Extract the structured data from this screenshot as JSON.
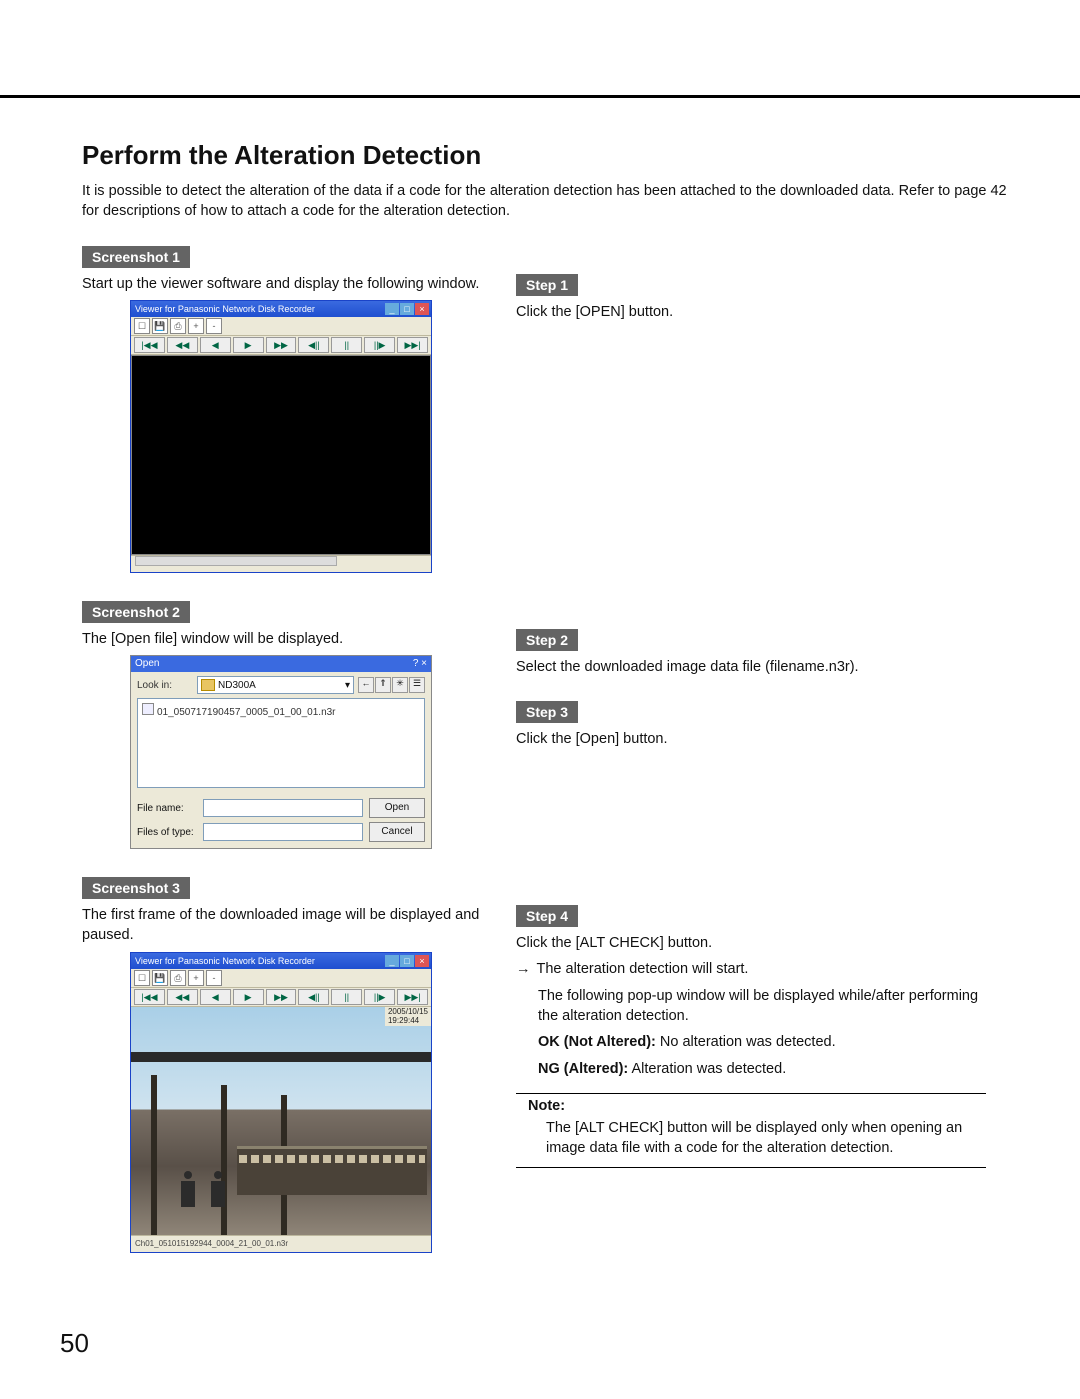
{
  "page_number": "50",
  "heading": "Perform the Alteration Detection",
  "intro": "It is possible to detect the alteration of the data if a code for the alteration detection has been attached to the downloaded data. Refer to page 42 for descriptions of how to attach a code for the alteration detection.",
  "screenshot1": {
    "label": "Screenshot 1",
    "caption": "Start up the viewer software and display the following window.",
    "window": {
      "title": "Viewer for Panasonic Network Disk Recorder",
      "toolbar_icons": [
        "open-icon",
        "save-icon",
        "print-icon",
        "zoom-in-icon",
        "zoom-out-icon"
      ],
      "transport": [
        "|◀◀",
        "◀◀",
        "◀",
        "▶",
        "▶▶",
        "◀||",
        "||",
        "||▶",
        "▶▶|"
      ]
    }
  },
  "step1": {
    "label": "Step 1",
    "text": "Click the [OPEN] button."
  },
  "screenshot2": {
    "label": "Screenshot 2",
    "caption": "The [Open file] window will be displayed.",
    "dialog": {
      "title": "Open",
      "lookin_label": "Look in:",
      "lookin_value": "ND300A",
      "file_listed": "01_050717190457_0005_01_00_01.n3r",
      "filename_label": "File name:",
      "filetype_label": "Files of type:",
      "open_btn": "Open",
      "cancel_btn": "Cancel"
    }
  },
  "step2": {
    "label": "Step 2",
    "text": "Select the downloaded image data file (filename.n3r)."
  },
  "step3": {
    "label": "Step 3",
    "text": "Click the [Open] button."
  },
  "screenshot3": {
    "label": "Screenshot 3",
    "caption": "The first frame of the downloaded image will be displayed and paused.",
    "window": {
      "title": "Viewer for Panasonic Network Disk Recorder",
      "timestamp_line1": "2005/10/15",
      "timestamp_line2": "19:29:44",
      "status": "Ch01_051015192944_0004_21_00_01.n3r"
    }
  },
  "step4": {
    "label": "Step 4",
    "line1": "Click the [ALT CHECK] button.",
    "arrow": "→",
    "line2": "The alteration detection will start.",
    "line3": "The following pop-up window will be displayed while/after performing the alteration detection.",
    "ok_label": "OK (Not Altered):",
    "ok_text": " No alteration was detected.",
    "ng_label": "NG (Altered):",
    "ng_text": " Alteration was detected."
  },
  "note": {
    "label": "Note:",
    "text": "The [ALT CHECK] button will be displayed only when opening an image data file with a code for the alteration detection."
  }
}
